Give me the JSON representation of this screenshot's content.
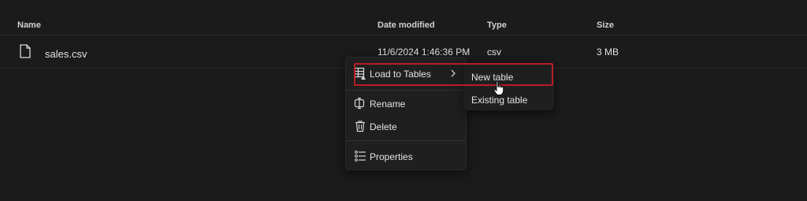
{
  "header": {
    "name": "Name",
    "date_modified": "Date modified",
    "type": "Type",
    "size": "Size"
  },
  "files": [
    {
      "name": "sales.csv",
      "date": "11/6/2024 1:46:36 PM",
      "type": "csv",
      "size": "3 MB",
      "icon": "file-icon"
    }
  ],
  "context_menu": {
    "items": [
      {
        "label": "Load to Tables",
        "icon": "table-load-icon",
        "has_submenu": true
      },
      {
        "label": "Rename",
        "icon": "rename-icon"
      },
      {
        "label": "Delete",
        "icon": "trash-icon"
      },
      {
        "label": "Properties",
        "icon": "properties-icon"
      }
    ],
    "submenu": [
      {
        "label": "New table"
      },
      {
        "label": "Existing table"
      }
    ]
  },
  "colors": {
    "background": "#1b1b1c",
    "menu_background": "#1f1f20",
    "highlight_border": "#b81d24"
  }
}
